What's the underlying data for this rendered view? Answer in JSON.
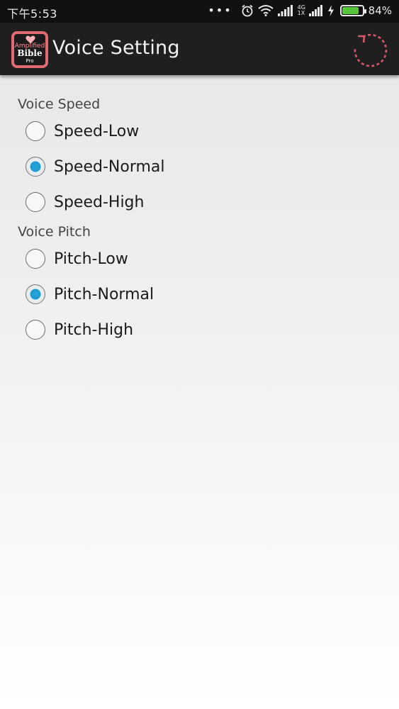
{
  "status_bar": {
    "time": "下午5:53",
    "dots": "•••",
    "network_top": "4G",
    "network_bottom": "1X",
    "battery_percent": "84%",
    "battery_level": 0.84,
    "battery_color": "#58c63a"
  },
  "app": {
    "icon_line1": "Amplified",
    "icon_line2": "Bible",
    "icon_line3": "Pro",
    "title": "Voice Setting",
    "accent": "#e26a73",
    "refresh_icon": "refresh-icon"
  },
  "sections": [
    {
      "label": "Voice Speed",
      "options": [
        "Speed-Low",
        "Speed-Normal",
        "Speed-High"
      ],
      "selected": "Speed-Normal"
    },
    {
      "label": "Voice Pitch",
      "options": [
        "Pitch-Low",
        "Pitch-Normal",
        "Pitch-High"
      ],
      "selected": "Pitch-Normal"
    }
  ],
  "radio_checked_color": "#1e98d0"
}
